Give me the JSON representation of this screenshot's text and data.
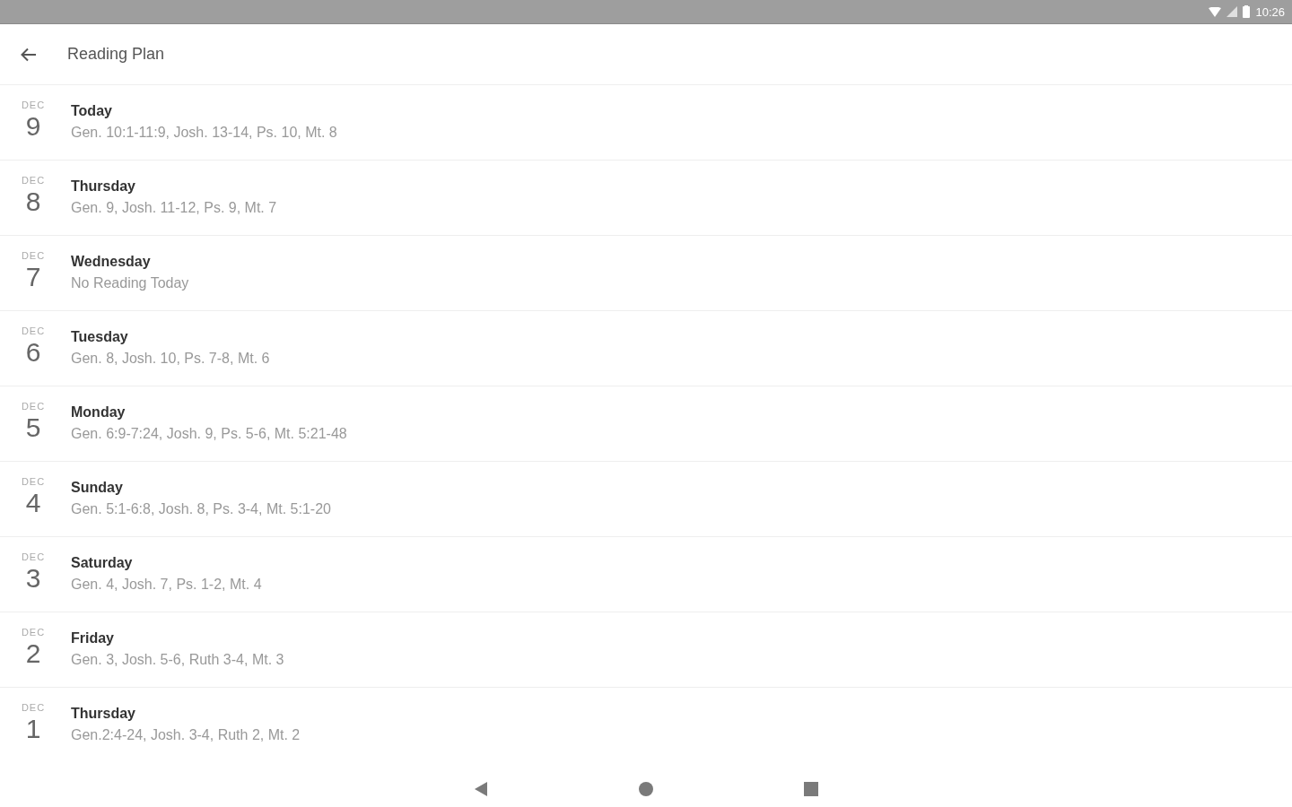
{
  "status_bar": {
    "time": "10:26"
  },
  "app_bar": {
    "title": "Reading Plan"
  },
  "readings": [
    {
      "month": "DEC",
      "day": "9",
      "title": "Today",
      "passages": "Gen. 10:1-11:9, Josh. 13-14, Ps. 10, Mt. 8"
    },
    {
      "month": "DEC",
      "day": "8",
      "title": "Thursday",
      "passages": "Gen. 9, Josh. 11-12, Ps. 9, Mt. 7"
    },
    {
      "month": "DEC",
      "day": "7",
      "title": "Wednesday",
      "passages": "No Reading Today"
    },
    {
      "month": "DEC",
      "day": "6",
      "title": "Tuesday",
      "passages": "Gen. 8, Josh. 10, Ps. 7-8, Mt. 6"
    },
    {
      "month": "DEC",
      "day": "5",
      "title": "Monday",
      "passages": "Gen. 6:9-7:24, Josh. 9, Ps. 5-6, Mt. 5:21-48"
    },
    {
      "month": "DEC",
      "day": "4",
      "title": "Sunday",
      "passages": "Gen. 5:1-6:8, Josh. 8, Ps. 3-4, Mt. 5:1-20"
    },
    {
      "month": "DEC",
      "day": "3",
      "title": "Saturday",
      "passages": "Gen. 4, Josh. 7, Ps. 1-2, Mt. 4"
    },
    {
      "month": "DEC",
      "day": "2",
      "title": "Friday",
      "passages": "Gen. 3, Josh. 5-6, Ruth 3-4, Mt. 3"
    },
    {
      "month": "DEC",
      "day": "1",
      "title": "Thursday",
      "passages": "Gen.2:4-24, Josh. 3-4, Ruth 2, Mt. 2"
    }
  ]
}
